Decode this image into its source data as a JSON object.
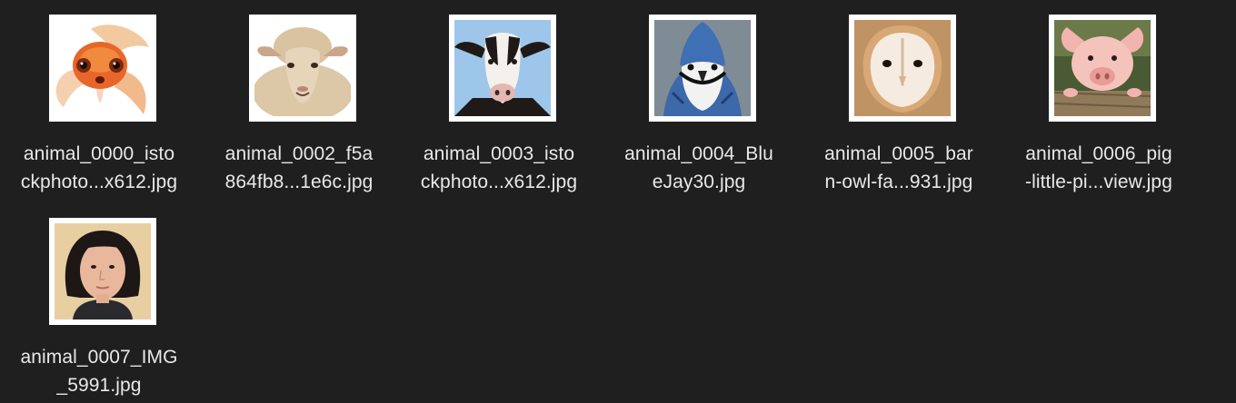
{
  "files": [
    {
      "line1": "animal_0000_isto",
      "line2": "ckphoto...x612.jpg",
      "thumbnail": "goldfish"
    },
    {
      "line1": "animal_0002_f5a",
      "line2": "864fb8...1e6c.jpg",
      "thumbnail": "sheep"
    },
    {
      "line1": "animal_0003_isto",
      "line2": "ckphoto...x612.jpg",
      "thumbnail": "cow"
    },
    {
      "line1": "animal_0004_Blu",
      "line2": "eJay30.jpg",
      "thumbnail": "blue-jay"
    },
    {
      "line1": "animal_0005_bar",
      "line2": "n-owl-fa...931.jpg",
      "thumbnail": "barn-owl"
    },
    {
      "line1": "animal_0006_pig",
      "line2": "-little-pi...view.jpg",
      "thumbnail": "pig"
    },
    {
      "line1": "animal_0007_IMG",
      "line2": "_5991.jpg",
      "thumbnail": "person"
    }
  ],
  "colors": {
    "background": "#1f1f1f",
    "label": "#e8e8e8",
    "frame": "#ffffff"
  }
}
